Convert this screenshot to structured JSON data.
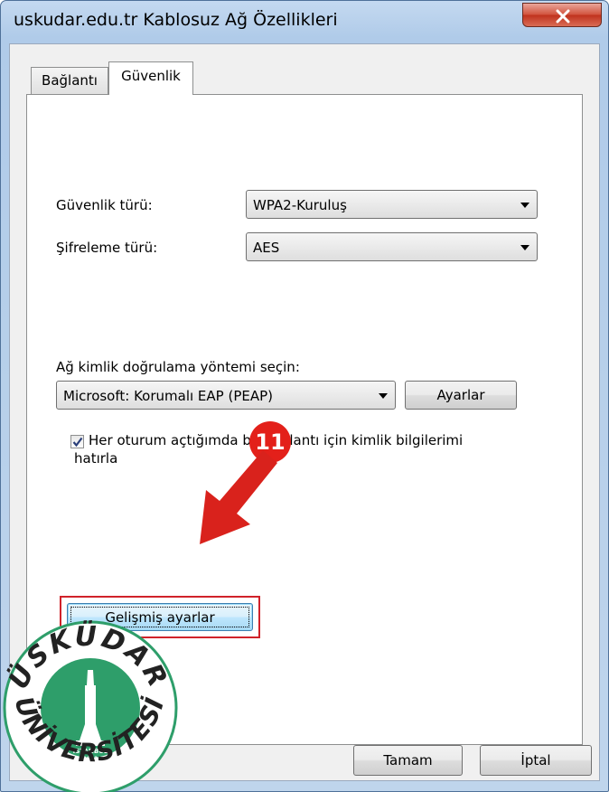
{
  "window": {
    "title": "uskudar.edu.tr Kablosuz Ağ Özellikleri"
  },
  "tabs": [
    {
      "label": "Bağlantı",
      "active": false
    },
    {
      "label": "Güvenlik",
      "active": true
    }
  ],
  "security": {
    "type_label": "Güvenlik türü:",
    "type_value": "WPA2-Kuruluş",
    "encryption_label": "Şifreleme türü:",
    "encryption_value": "AES"
  },
  "auth": {
    "method_label": "Ağ kimlik doğrulama yöntemi seçin:",
    "method_value": "Microsoft: Korumalı EAP (PEAP)",
    "settings_button": "Ayarlar",
    "remember_line1": "Her oturum açtığımda bu bağlantı için kimlik bilgilerimi",
    "remember_line2": "hatırla",
    "remember_checked": true
  },
  "annotation": {
    "step_number": "11",
    "color": "#e3201a"
  },
  "advanced_button": "Gelişmiş ayarlar",
  "footer": {
    "ok_button": "Tamam",
    "cancel_button": "İptal"
  },
  "logo": {
    "top_text": "ÜSKÜDAR",
    "bottom_text": "ÜNİVERSİTESİ",
    "center_line1": "ISTANBUL",
    "center_line2": "2011",
    "color": "#2e9e6a"
  }
}
